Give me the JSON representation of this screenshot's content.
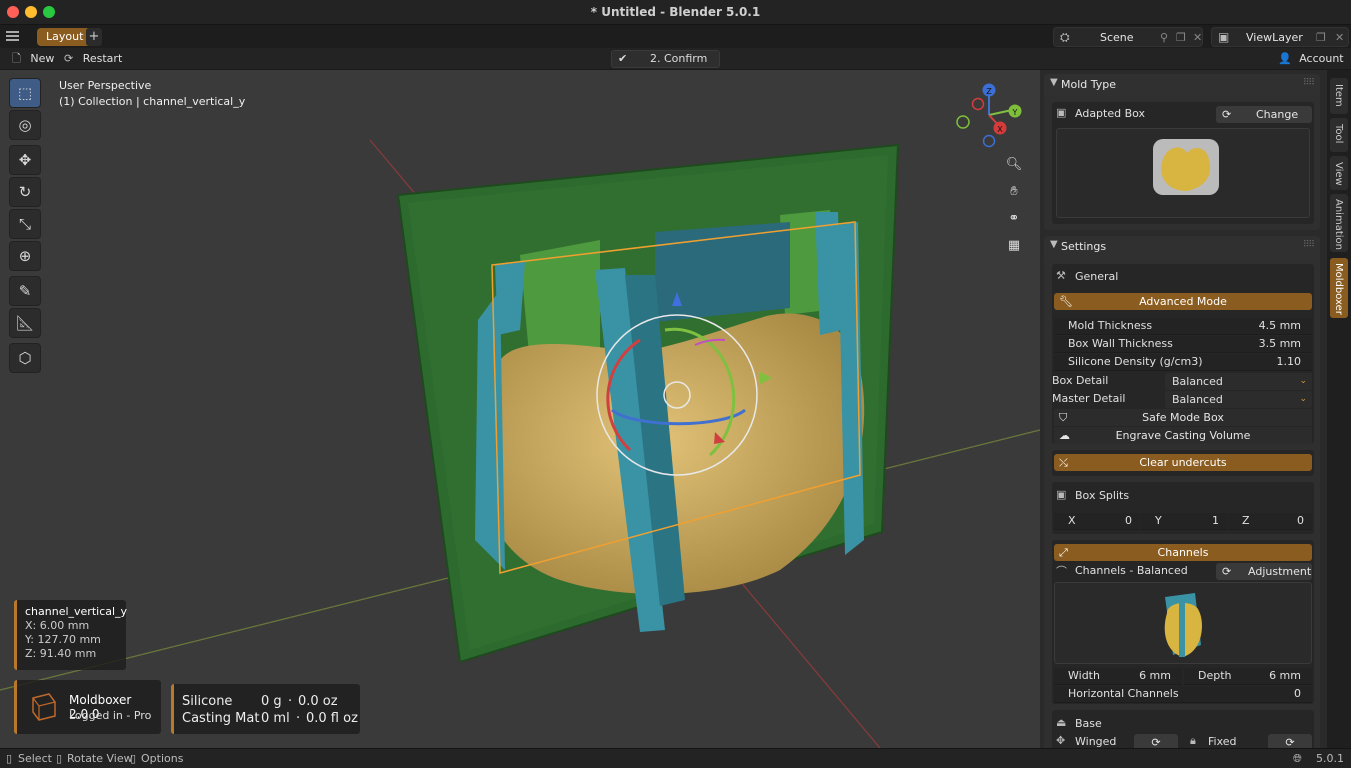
{
  "window": {
    "title": "* Untitled - Blender 5.0.1"
  },
  "workspace": {
    "tab": "Layout",
    "add": "+",
    "scene": "Scene",
    "view_layer": "ViewLayer"
  },
  "header": {
    "new_label": "New",
    "restart_label": "Restart",
    "confirm_label": "2. Confirm",
    "account_label": "Account"
  },
  "viewport": {
    "perspective": "User Perspective",
    "collection": "(1) Collection | channel_vertical_y",
    "gizmo_axes": [
      "Z",
      "Y",
      "X"
    ]
  },
  "object_info": {
    "name": "channel_vertical_y",
    "x": "X: 6.00 mm",
    "y": "Y: 127.70 mm",
    "z": "Z: 91.40 mm"
  },
  "moldboxer_info": {
    "name": "Moldboxer 2.0.0",
    "status": "Logged in - Pro"
  },
  "stats": {
    "silicone_label": "Silicone",
    "silicone_g": "0 g",
    "silicone_oz": "0.0 oz",
    "casting_label": "Casting Mat",
    "casting_ml": "0 ml",
    "casting_floz": "0.0 fl oz",
    "dot": "·"
  },
  "panel": {
    "mold_type": {
      "title": "Mold Type",
      "type_value": "Adapted Box",
      "change_label": "Change"
    },
    "settings": {
      "title": "Settings",
      "general_label": "General",
      "advanced_mode_label": "Advanced Mode",
      "fields": [
        {
          "label": "Mold Thickness",
          "value": "4.5 mm"
        },
        {
          "label": "Box Wall Thickness",
          "value": "3.5 mm"
        },
        {
          "label": "Silicone Density (g/cm3)",
          "value": "1.10"
        }
      ],
      "box_detail_label": "Box Detail",
      "box_detail_value": "Balanced",
      "master_detail_label": "Master Detail",
      "master_detail_value": "Balanced",
      "safe_mode_label": "Safe Mode Box",
      "engrave_label": "Engrave Casting Volume",
      "clear_undercuts_label": "Clear undercuts",
      "box_splits_label": "Box Splits",
      "splits": {
        "x_label": "X",
        "x_value": "0",
        "y_label": "Y",
        "y_value": "1",
        "z_label": "Z",
        "z_value": "0"
      },
      "channels_label": "Channels",
      "channels_preset": "Channels - Balanced",
      "adjustment_label": "Adjustment",
      "width_label": "Width",
      "width_value": "6 mm",
      "depth_label": "Depth",
      "depth_value": "6 mm",
      "horizontal_label": "Horizontal Channels",
      "horizontal_value": "0",
      "base_label": "Base",
      "winged_label": "Winged",
      "fixed_label": "Fixed"
    }
  },
  "side_tabs": [
    "Item",
    "Tool",
    "View",
    "Animation",
    "Moldboxer"
  ],
  "status_bar": {
    "select": "Select",
    "rotate": "Rotate View",
    "options": "Options",
    "version": "5.0.1"
  },
  "colors": {
    "accent": "#8a5c1f",
    "active_tool": "#3f5c86",
    "mold_green": "#2f6a2f",
    "master": "#c9a75a",
    "channel": "#2f7f8f"
  }
}
